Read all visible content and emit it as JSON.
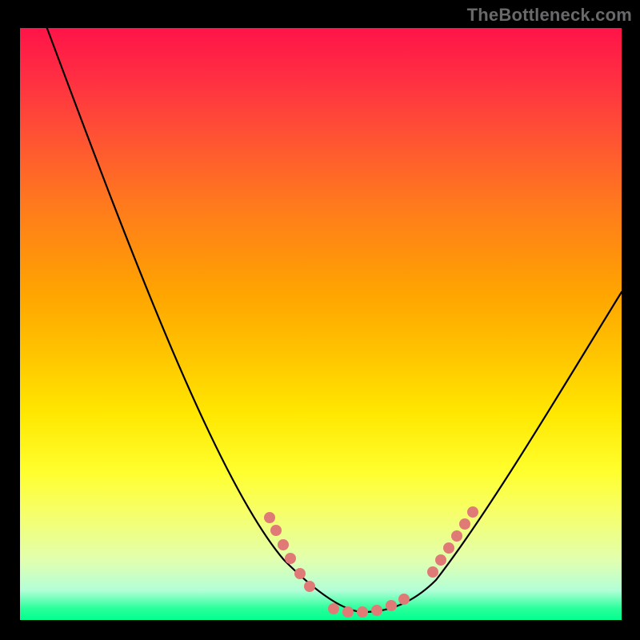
{
  "watermark": "TheBottleneck.com",
  "chart_data": {
    "type": "line",
    "title": "",
    "xlabel": "",
    "ylabel": "",
    "xlim": [
      0,
      100
    ],
    "ylim": [
      0,
      100
    ],
    "series": [
      {
        "name": "bottleneck-curve",
        "x": [
          4,
          10,
          20,
          30,
          40,
          45,
          50,
          55,
          60,
          65,
          70,
          80,
          90,
          100
        ],
        "y": [
          100,
          85,
          62,
          40,
          20,
          12,
          5,
          1,
          0,
          3,
          10,
          28,
          45,
          56
        ]
      }
    ],
    "marker_ranges": [
      {
        "name": "beads-left",
        "x_range": [
          41,
          48
        ],
        "y_range": [
          6,
          18
        ]
      },
      {
        "name": "beads-bottom",
        "x_range": [
          52,
          64
        ],
        "y_range": [
          0,
          4
        ]
      },
      {
        "name": "beads-right",
        "x_range": [
          68,
          75
        ],
        "y_range": [
          8,
          20
        ]
      }
    ],
    "background": {
      "gradient": "vertical",
      "stops": [
        "#ff1448",
        "#ffa500",
        "#ffff2e",
        "#00ff8f"
      ]
    },
    "legend": false,
    "grid": false
  }
}
